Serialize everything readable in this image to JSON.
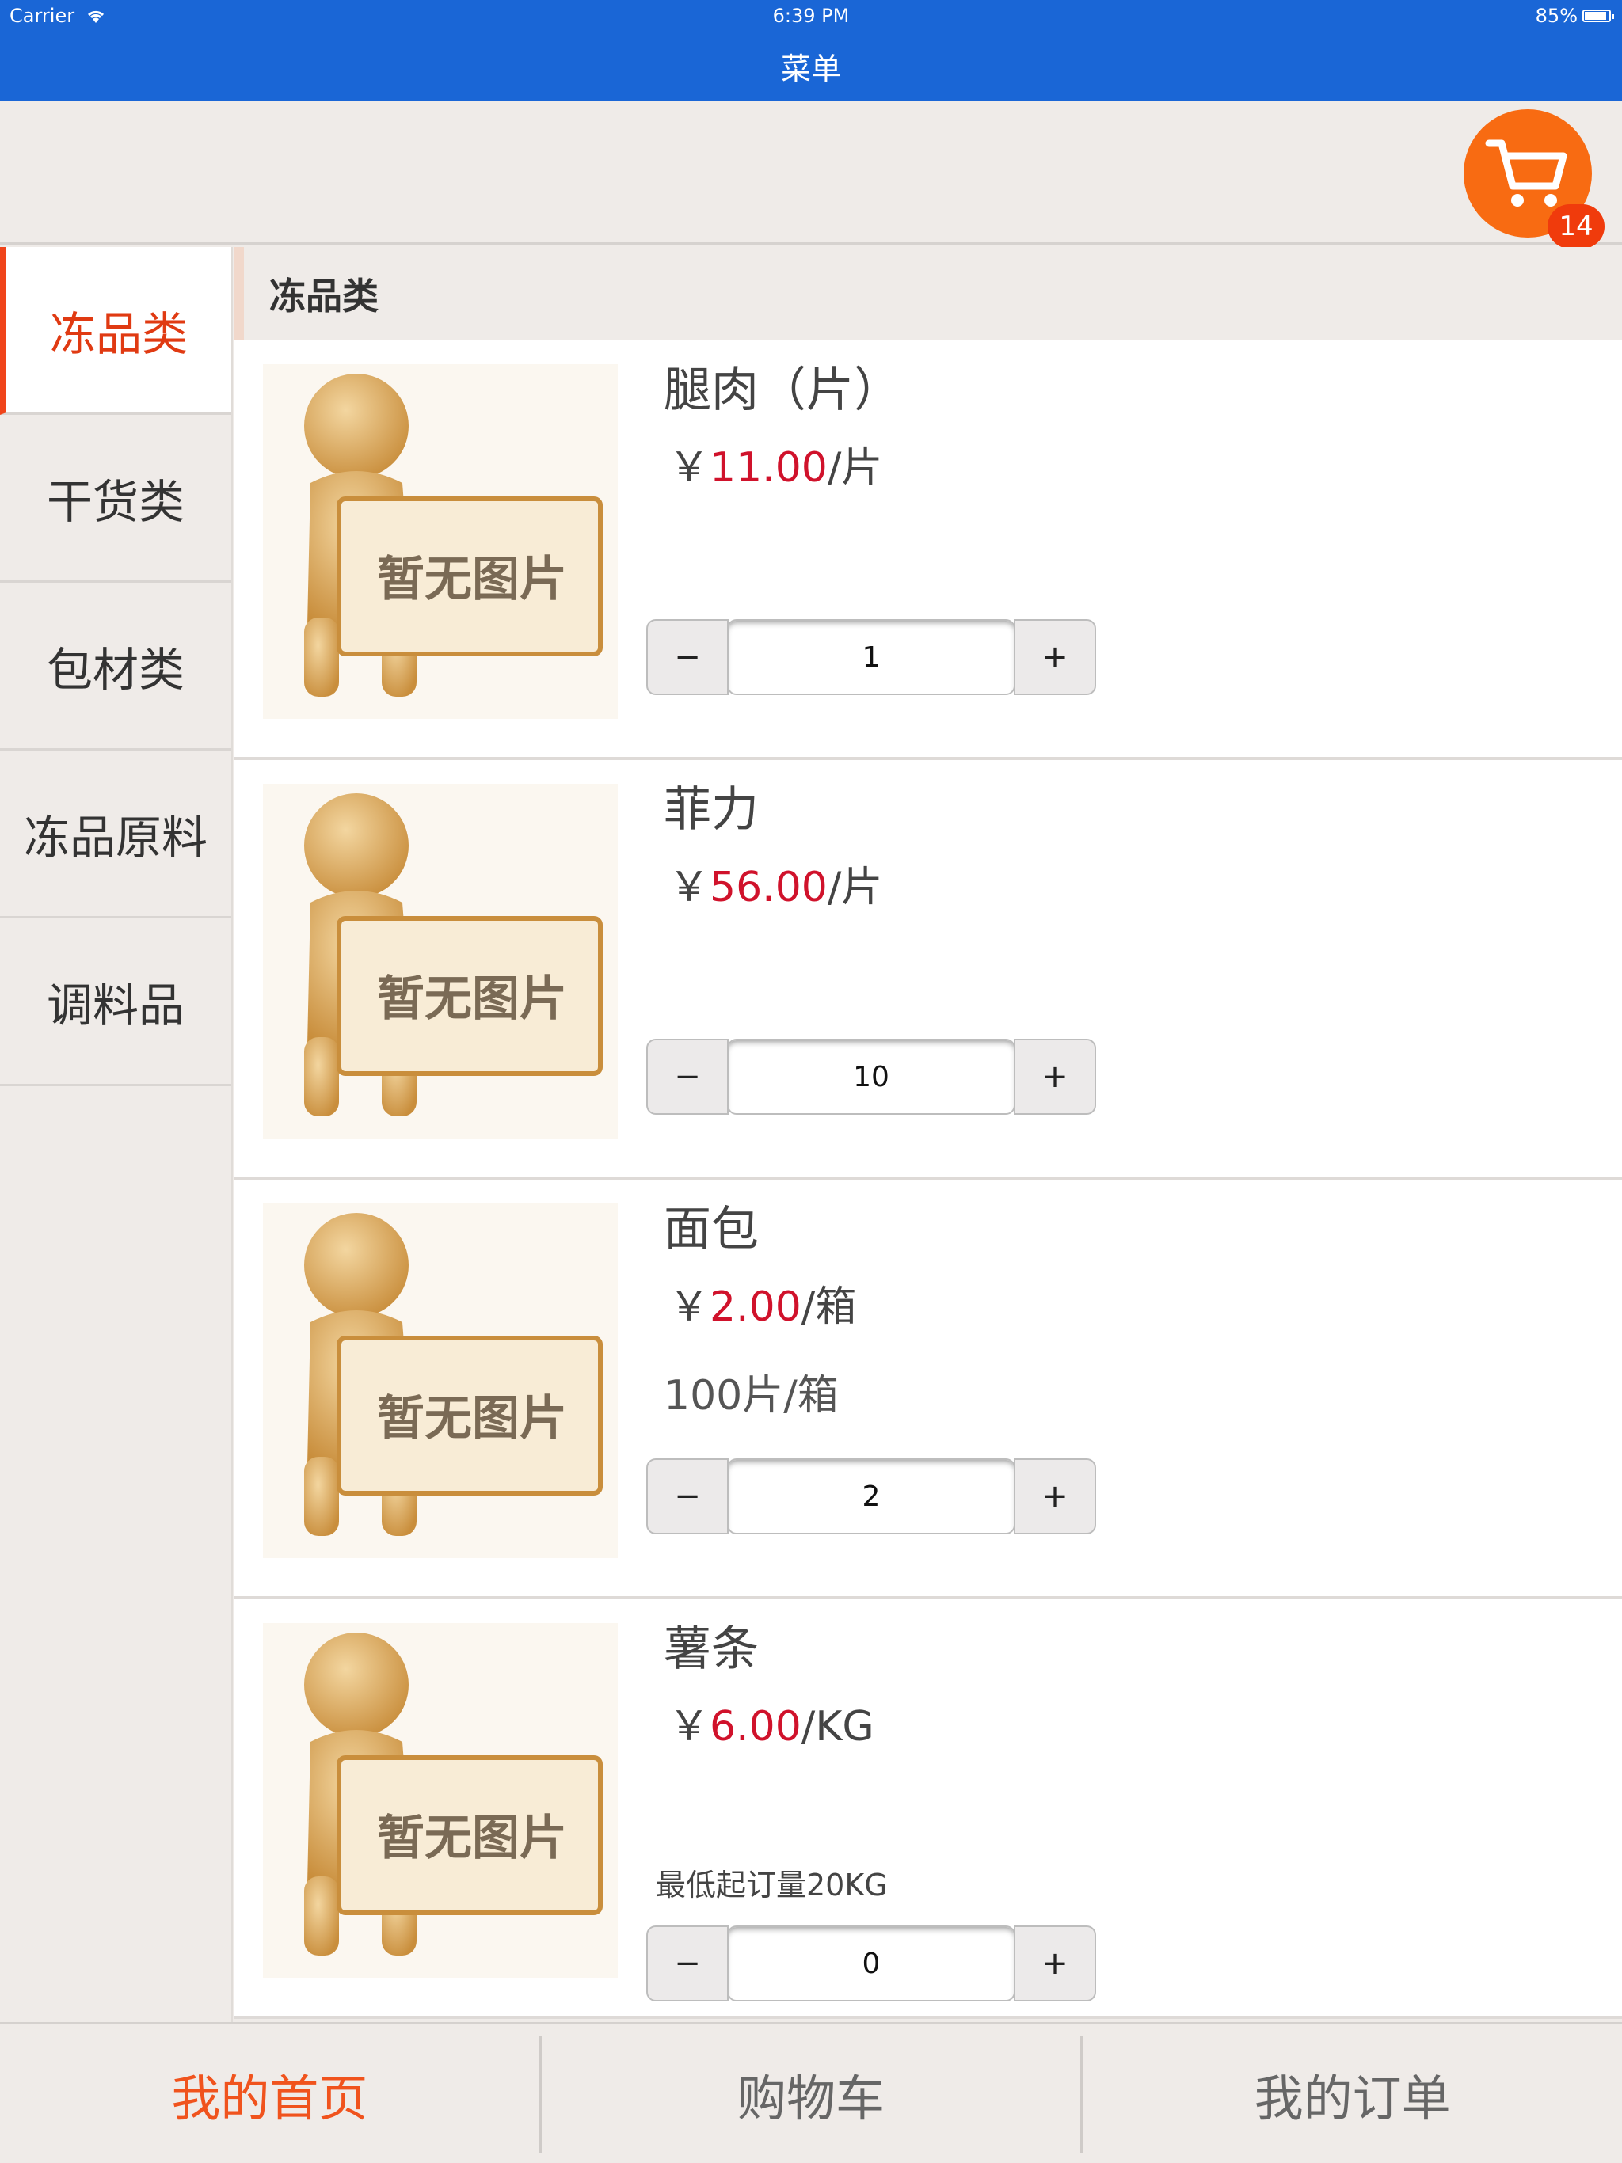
{
  "status_bar": {
    "carrier": "Carrier",
    "time": "6:39 PM",
    "battery": "85%"
  },
  "nav": {
    "title": "菜单"
  },
  "cart": {
    "badge_count": "14",
    "icon": "shopping-cart-icon",
    "color": "#f86b12"
  },
  "sidebar": {
    "items": [
      {
        "label": "冻品类",
        "active": true
      },
      {
        "label": "干货类"
      },
      {
        "label": "包材类"
      },
      {
        "label": "冻品原料"
      },
      {
        "label": "调料品"
      }
    ]
  },
  "section": {
    "title": "冻品类"
  },
  "placeholder_text": "暂无图片",
  "products": [
    {
      "name": "腿肉（片）",
      "currency": "￥",
      "price": "11.00",
      "unit": "/片",
      "qty": "1"
    },
    {
      "name": "菲力",
      "currency": "￥",
      "price": "56.00",
      "unit": "/片",
      "qty": "10"
    },
    {
      "name": "面包",
      "currency": "￥",
      "price": "2.00",
      "unit": "/箱",
      "spec": "100片/箱",
      "qty": "2"
    },
    {
      "name": "薯条",
      "currency": "￥",
      "price": "6.00",
      "unit": "/KG",
      "min_order": "最低起订量20KG",
      "qty": "0"
    }
  ],
  "stepper": {
    "minus": "−",
    "plus": "+"
  },
  "tabbar": {
    "items": [
      {
        "label": "我的首页",
        "active": true
      },
      {
        "label": "购物车"
      },
      {
        "label": "我的订单"
      }
    ]
  },
  "colors": {
    "nav_blue": "#1a66d6",
    "accent_orange": "#f0531d",
    "price_red": "#d0122b"
  }
}
